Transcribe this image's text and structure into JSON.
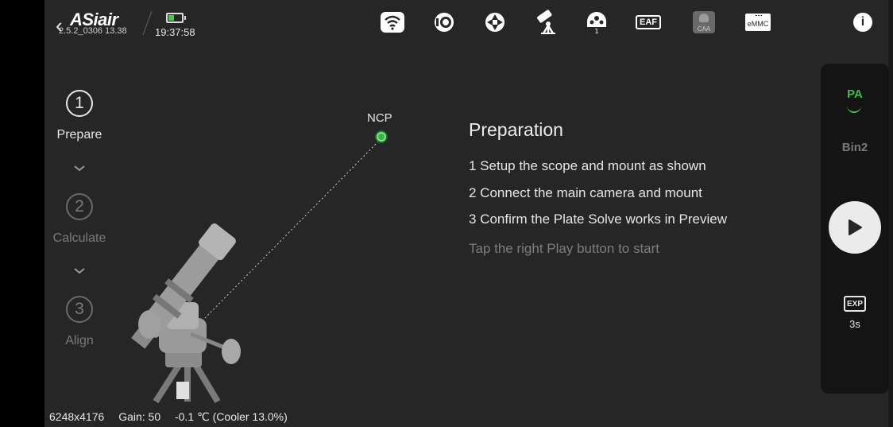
{
  "topbar": {
    "back_glyph": "‹",
    "logo": "ASiair",
    "version": "2.5.2_0306 13.38",
    "battery_level": 0.45,
    "time": "19:37:58",
    "icons": [
      "wifi-icon",
      "camera-icon",
      "guide-target-icon",
      "telescope-mount-icon",
      "filter-wheel-icon",
      "eaf-icon",
      "caa-icon",
      "emmc-storage-icon",
      "info-icon"
    ],
    "eaf_label": "EAF",
    "caa_label": "CAA",
    "emmc_label": "eMMC",
    "info_glyph": "i"
  },
  "steps": [
    {
      "number": "1",
      "label": "Prepare",
      "active": true
    },
    {
      "number": "2",
      "label": "Calculate",
      "active": false
    },
    {
      "number": "3",
      "label": "Align",
      "active": false
    }
  ],
  "scene": {
    "ncp_label": "NCP",
    "ncp_color": "#35b445"
  },
  "instructions": {
    "title": "Preparation",
    "lines": [
      "1 Setup the scope and mount as shown",
      "2 Connect the main camera and mount",
      "3 Confirm the Plate Solve works in Preview"
    ],
    "hint": "Tap the right Play button to start"
  },
  "right_panel": {
    "pa_label": "PA",
    "bin_label": "Bin2",
    "exp_label": "EXP",
    "exp_value": "3s",
    "accent": "#3dbd4e"
  },
  "status": {
    "resolution": "6248x4176",
    "gain": "Gain: 50",
    "temperature": "-0.1 ℃ (Cooler 13.0%)"
  }
}
